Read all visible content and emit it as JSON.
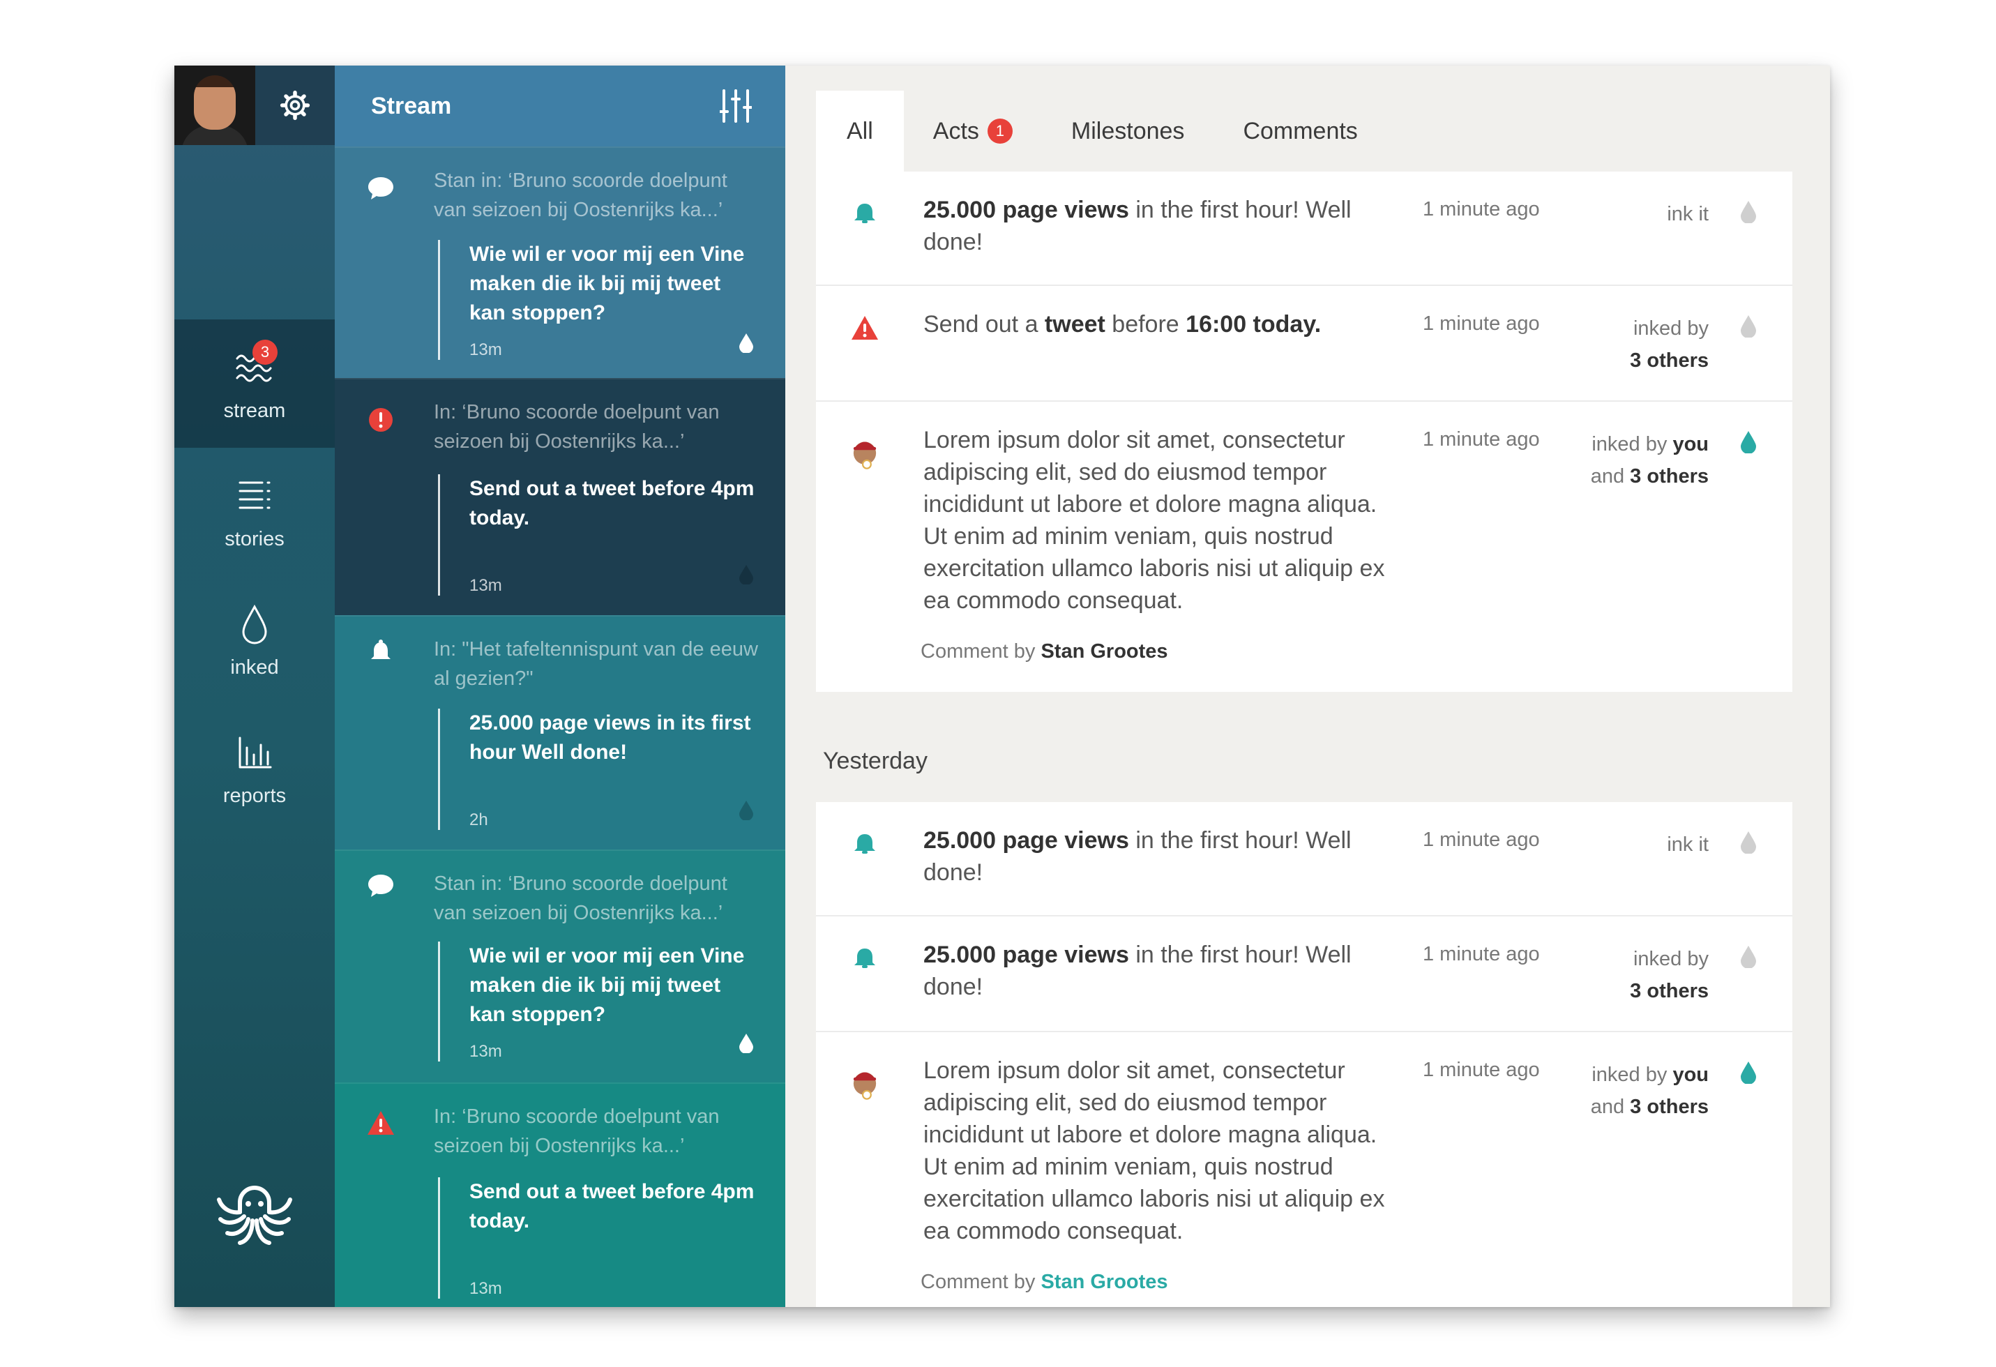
{
  "nav": {
    "items": [
      {
        "label": "stream",
        "badge": "3",
        "icon": "waves-icon"
      },
      {
        "label": "stories",
        "icon": "list-icon"
      },
      {
        "label": "inked",
        "icon": "drop-icon"
      },
      {
        "label": "reports",
        "icon": "bars-icon"
      }
    ],
    "accent": "#e8413a"
  },
  "stream": {
    "title": "Stream",
    "cards": [
      {
        "icon": "chat-bubble-icon",
        "context": "Stan in: ‘Bruno scoorde doelpunt van seizoen bij Oostenrijks ka...’",
        "title": "Wie wil er voor mij een Vine maken die ik bij mij tweet kan stoppen?",
        "time": "13m"
      },
      {
        "icon": "alert-circle-icon",
        "context": "In: ‘Bruno scoorde doelpunt van seizoen bij Oostenrijks ka...’",
        "title": "Send out a tweet before 4pm today.",
        "time": "13m"
      },
      {
        "icon": "bell-icon",
        "context": "In: \"Het tafeltennispunt van de eeuw al gezien?\"",
        "title": "25.000 page views in its first hour Well done!",
        "time": "2h"
      },
      {
        "icon": "chat-bubble-icon",
        "context": "Stan in: ‘Bruno scoorde doelpunt van seizoen bij Oostenrijks ka...’",
        "title": "Wie wil er voor mij een Vine maken die ik bij mij tweet kan stoppen?",
        "time": "13m"
      },
      {
        "icon": "warning-triangle-icon",
        "context": "In: ‘Bruno scoorde doelpunt van seizoen bij Oostenrijks ka...’",
        "title": "Send out a tweet before 4pm today.",
        "time": "13m"
      }
    ]
  },
  "tabs": [
    {
      "label": "All"
    },
    {
      "label": "Acts",
      "badge": "1"
    },
    {
      "label": "Milestones"
    },
    {
      "label": "Comments"
    }
  ],
  "feed": {
    "section_yesterday": "Yesterday",
    "strings": {
      "page_views": "25.000 page views",
      "first_hour": " in the first hour! Well done!",
      "send_out": "Send out a ",
      "tweet": "tweet",
      "before": " before ",
      "deadline": "16:00 today.",
      "time": "1 minute ago",
      "ink_it": "ink it",
      "inked_by": "inked by",
      "three_others": "3 others",
      "you": "you",
      "and": "and",
      "lorem": "Lorem ipsum dolor sit amet, consectetur adipiscing elit, sed do eiusmod tempor incididunt ut labore et dolore magna aliqua. Ut enim ad minim veniam, quis nostrud exercitation ullamco laboris nisi ut aliquip ex ea commodo consequat.",
      "comment_by": "Comment by ",
      "author": "Stan Grootes"
    }
  },
  "colors": {
    "teal": "#2aaaa5",
    "red": "#e8413a",
    "drop_gray": "#cfcfcf"
  }
}
